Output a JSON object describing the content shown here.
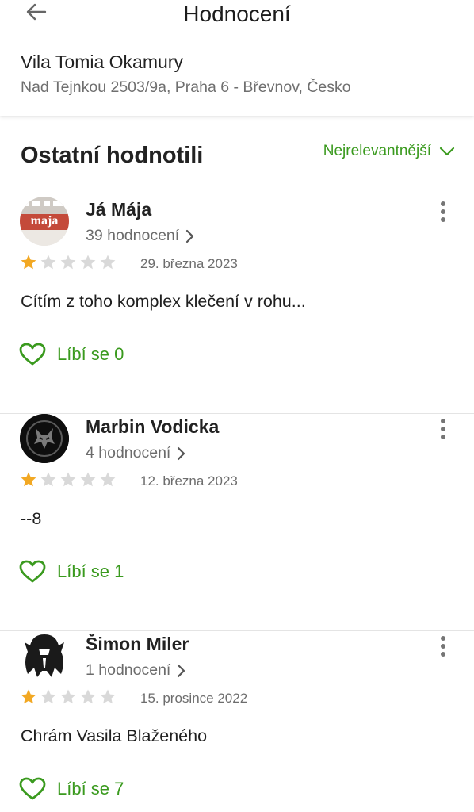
{
  "header": {
    "title": "Hodnocení",
    "place_name": "Vila Tomia Okamury",
    "place_address": "Nad Tejnkou 2503/9a, Praha 6 - Břevnov, Česko"
  },
  "section": {
    "title": "Ostatní hodnotili",
    "sort_label": "Nejrelevantnější"
  },
  "colors": {
    "accent": "#3a9a1e",
    "star_filled": "#f2a823",
    "star_empty": "#d9d9d9"
  },
  "reviews": [
    {
      "author": "Já Mája",
      "ratings_count": "39 hodnocení",
      "rating": 1,
      "max_rating": 5,
      "date": "29. března 2023",
      "text": "Cítím z toho komplex klečení v rohu...",
      "like_label": "Líbí se 0",
      "avatar_text": "maja"
    },
    {
      "author": "Marbin Vodicka",
      "ratings_count": "4 hodnocení",
      "rating": 1,
      "max_rating": 5,
      "date": "12. března 2023",
      "text": "--8",
      "like_label": "Líbí se 1"
    },
    {
      "author": "Šimon Miler",
      "ratings_count": "1 hodnocení",
      "rating": 1,
      "max_rating": 5,
      "date": "15. prosince 2022",
      "text": "Chrám Vasila Blaženého",
      "like_label": "Líbí se 7"
    }
  ]
}
